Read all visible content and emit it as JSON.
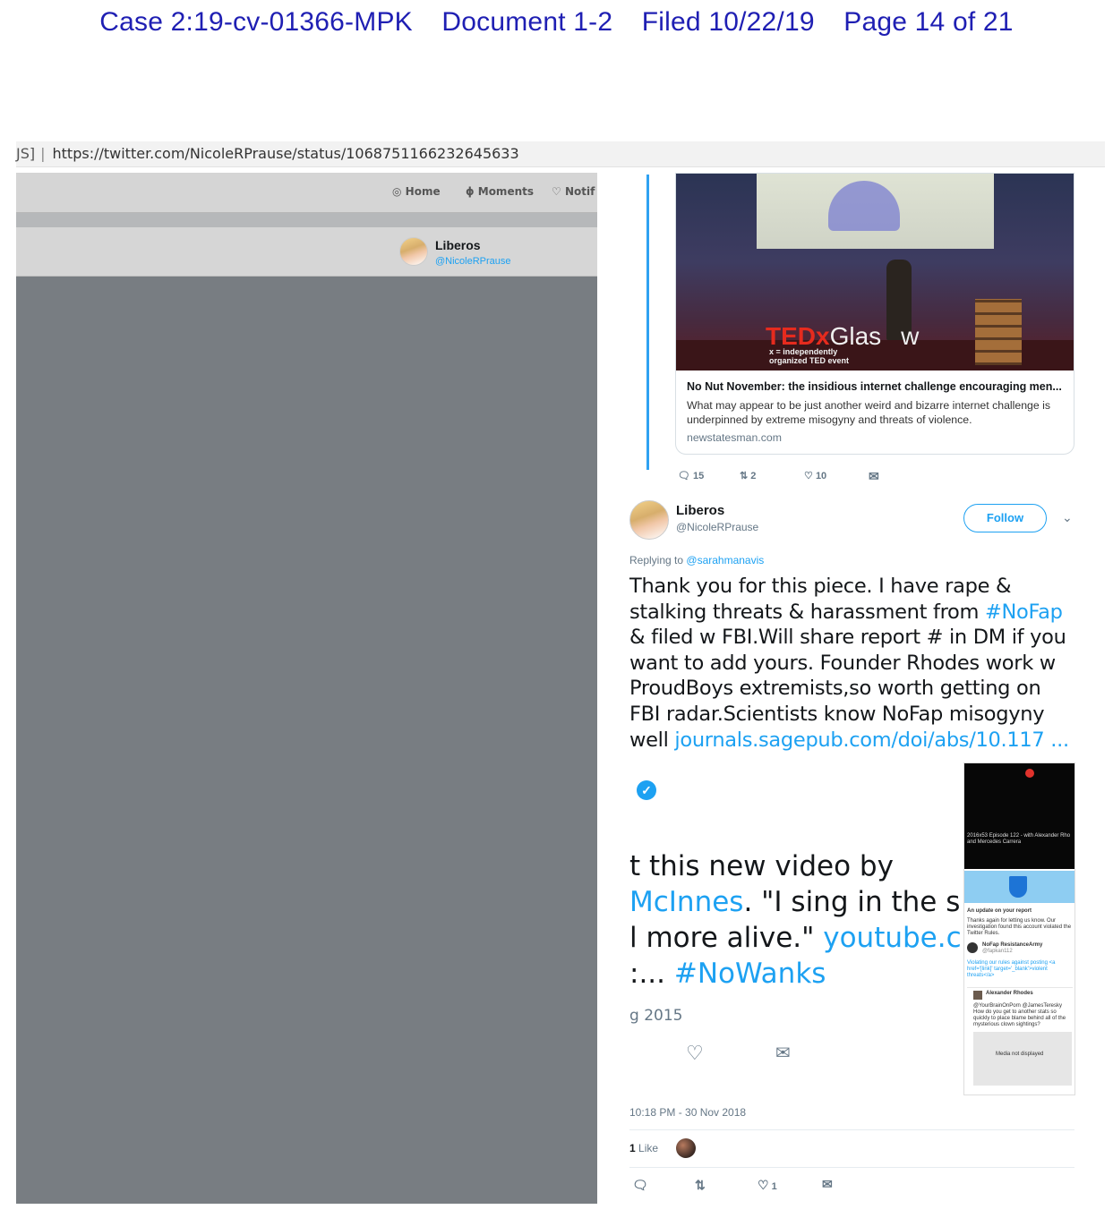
{
  "pdf_header": {
    "case": "Case 2:19-cv-01366-MPK",
    "document": "Document 1-2",
    "filed": "Filed 10/22/19",
    "page": "Page 14 of 21"
  },
  "browser": {
    "url_prefix": "JS]",
    "url": "https://twitter.com/NicoleRPrause/status/1068751166232645633"
  },
  "topnav": {
    "home": "Home",
    "moments": "Moments",
    "notifications": "Notif"
  },
  "profile_bar": {
    "name": "Liberos",
    "handle": "@NicoleRPrause"
  },
  "link_card": {
    "tedx_brand": "TEDx",
    "tedx_city": "Glas",
    "tedx_city_end": "w",
    "tedx_sub1": "x = independently",
    "tedx_sub2": "organized TED event",
    "title": "No Nut November: the insidious internet challenge encouraging men...",
    "description": "What may appear to be just another weird and bizarre internet challenge is underpinned by extreme misogyny and threats of violence.",
    "domain": "newstatesman.com"
  },
  "parent_actions": {
    "replies": "15",
    "retweets": "2",
    "likes": "10"
  },
  "tweet": {
    "name": "Liberos",
    "handle": "@NicoleRPrause",
    "follow_label": "Follow",
    "replying_label": "Replying to",
    "replying_handle": "@sarahmanavis",
    "text_1": "Thank you for this piece. I have rape & stalking threats & harassment from ",
    "hashtag": "#NoFap",
    "text_2": " & filed w FBI.Will share report # in DM if you want to add yours. Founder Rhodes work w ProudBoys extremists,so worth getting on FBI radar.Scientists know NoFap misogyny well ",
    "link": "journals.sagepub.com/doi/abs/10.117 ...",
    "timestamp": "10:18 PM - 30 Nov 2018",
    "like_count": "1",
    "like_label": "Like",
    "footer_likes": "1"
  },
  "embedded_quote": {
    "line1": "t this new video by",
    "line2_link": "McInnes",
    "line2_text": ". \"I sing in the sh",
    "line3_text": "l more alive.\" ",
    "line3_link": "youtube.co",
    "line4_text": ":... ",
    "line4_link": "#NoWanks",
    "date": "g 2015"
  },
  "thumbnail": {
    "video_caption": "2016x53 Episode 122 - with Alexander Rho and Mercedes Carrera",
    "update_title": "An update on your report",
    "update_body": "Thanks again for letting us know. Our investigation found this account violated the Twitter Rules.",
    "account_name": "NoFap ResistanceArmy",
    "account_handle": "@fapkan112",
    "violating_note": "Violating our rules against posting <a href='[link]' target='_blank'>violent threats</a>",
    "reply_name": "Alexander Rhodes",
    "reply_text": "@YourBrainOnPorn @JamesTeresky How do you get to another stats so quickly to place blame behind all of the mysterious clown sightings?",
    "media_note": "Media not displayed"
  },
  "colors": {
    "header_blue": "#1f1fb3",
    "twitter_blue": "#1da1f2",
    "overlay_gray": "#787d82",
    "ted_red": "#e62b1e"
  },
  "icons": [
    "home-icon",
    "moments-icon",
    "bell-icon",
    "reply-icon",
    "retweet-icon",
    "heart-icon",
    "mail-icon",
    "chevron-down-icon",
    "verified-icon"
  ]
}
